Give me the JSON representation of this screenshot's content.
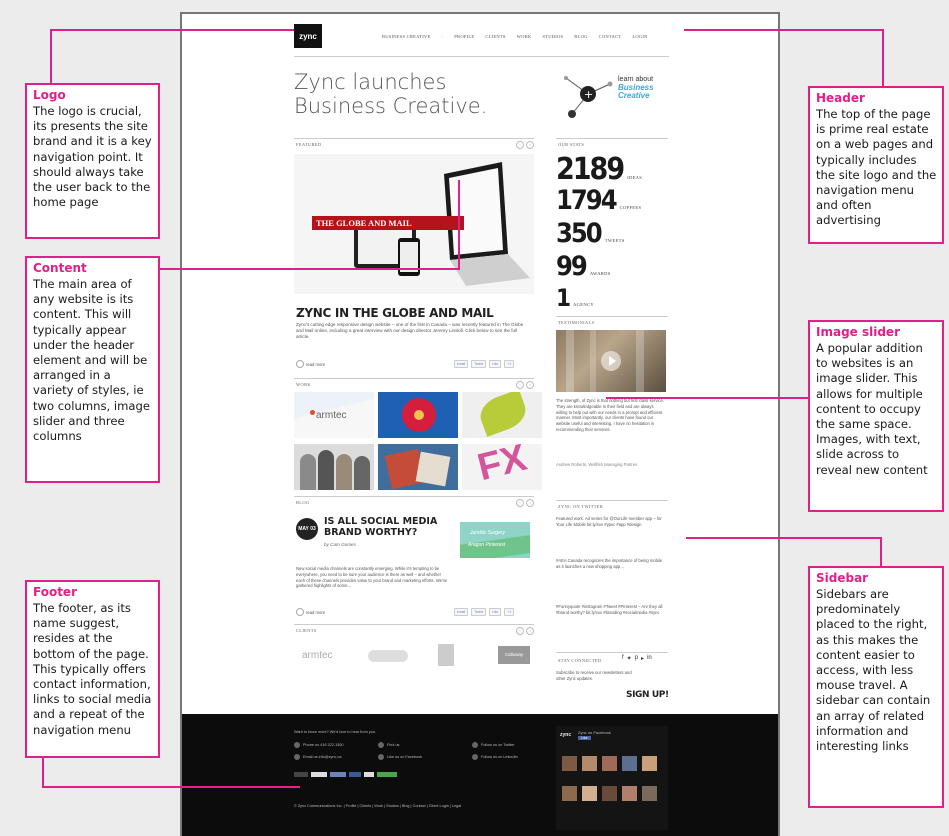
{
  "mock_page": {
    "logo": "zync",
    "nav": [
      "BUSINESS CREATIVE",
      "PROFILE",
      "CLIENTS",
      "WORK",
      "STUDIOS",
      "BLOG",
      "CONTACT",
      "LOGIN"
    ],
    "headline_line1": "Zync launches",
    "headline_line2": "Business Creative.",
    "learn_about": "learn about",
    "learn_business": "Business",
    "learn_creative": "Creative",
    "featured_label": "FEATURED",
    "featured_sign": "THE GLOBE AND MAIL",
    "featured_title": "ZYNC IN THE GLOBE AND MAIL",
    "featured_body": "Zync's cutting edge responsive design website – one of the first in Canada – was recently featured in The Globe and Mail online, including a great interview with our design director Jeremy Linskill. Click below to see the full article.",
    "read_more": "read more",
    "share": [
      "email",
      "Tweet",
      "Like",
      "+1"
    ],
    "work_label": "WORK",
    "work_tile_text": "armtec",
    "blog_label": "BLOG",
    "blog_day_line1": "MAY",
    "blog_day_line2": "03",
    "blog_title": "IS ALL SOCIAL MEDIA BRAND WORTHY?",
    "blog_by": "by Cam Gomes",
    "blog_img_text1": "Jumble Surgery",
    "blog_img_text2": "Aragon Pinterest",
    "blog_body": "New social media channels are constantly emerging. While it's tempting to be everywhere, you need to be sure your audience is there as well – and whether each of these channels provides value to your brand and marketing efforts. We've gathered highlights of some…",
    "clients_label": "CLIENTS",
    "clients": [
      "armtec",
      "",
      "",
      "Calloway"
    ],
    "our_stats_label": "OUR STATS",
    "stats": [
      {
        "number": "2189",
        "label": "IDEAS"
      },
      {
        "number": "1794",
        "label": "COFFEES"
      },
      {
        "number": "350",
        "label": "TWEETS"
      },
      {
        "number": "99",
        "label": "AWARDS"
      },
      {
        "number": "1",
        "label": "AGENCY"
      }
    ],
    "testimonials_label": "TESTIMONIALS",
    "testimonial_text": "The strength, of Zync is that nothing but first class service. They are knowledgeable in their field and are always willing to help out with our needs in a prompt and efficient manner. Most importantly, our clients have found our website useful and interesting. I have no hesitation in recommending their services.",
    "testimonial_author": "Andrew Roberts, Wellfish Managing Partner",
    "twitter_label": "ZYNC ON TWITTER",
    "tweets": [
      "Featured work: Ad series for @OurLife member app – for Your Life Mobile bit.ly/xxx #ypvc #app #design",
      "#AEA Canada recognizes the importance of being mobile as it launches a new shopping app…",
      "#Funnyquote #instagram #Tweet #Pinterest – Are they all #brand worthy? bit.ly/xxx #branding #socialmedia #sync"
    ],
    "stay_connected": "STAY CONNECTED",
    "subscribe_text": "Subscribe to receive our newsletters and other Zync updates.",
    "signup": "SIGN UP!",
    "footer_lead": "Want to know more? We'd love to hear from you.",
    "footer_links": [
      [
        "Phone us 416 322-1500",
        "Find us",
        "Follow us on Twitter"
      ],
      [
        "Email us info@zync.ca",
        "Like us on Facebook",
        "Follow us on LinkedIn"
      ]
    ],
    "footer_copyright": "© Zync Communications Inc. | Profile | Clients | Work | Studios | Blog | Contact | Client Login | Legal",
    "facebook_label": "Zync on Facebook",
    "facebook_like": "Like"
  },
  "callouts": {
    "logo": {
      "title": "Logo",
      "body": "The logo is crucial, its presents the site brand and it is a key navigation point. It should always take the user back to the home page"
    },
    "content": {
      "title": "Content",
      "body": "The main area of any website is its content. This will typically appear under the header element and will be arranged in a variety of styles, ie two columns, image slider and three columns"
    },
    "footer": {
      "title": "Footer",
      "body": "The footer, as its name suggest, resides at the bottom of the page. This typically offers contact information, links to social media and a repeat of the navigation menu"
    },
    "header": {
      "title": "Header",
      "body": "The top of the page is prime real estate on a web pages and typically includes the site logo and the navigation menu and often advertising"
    },
    "slider": {
      "title": "Image slider",
      "body": "A popular addition to websites is an image slider. This allows for multiple content to occupy the same space. Images, with text, slide across to reveal new content"
    },
    "sidebar": {
      "title": "Sidebar",
      "body": "Sidebars are predominately placed to the right, as this makes the content easier to access, with less mouse travel. A sidebar can contain an array of related information and interesting links"
    }
  },
  "colors": {
    "accent": "#e0208a",
    "footer_bg": "#0c0c0c",
    "page_bg": "#ececec"
  }
}
